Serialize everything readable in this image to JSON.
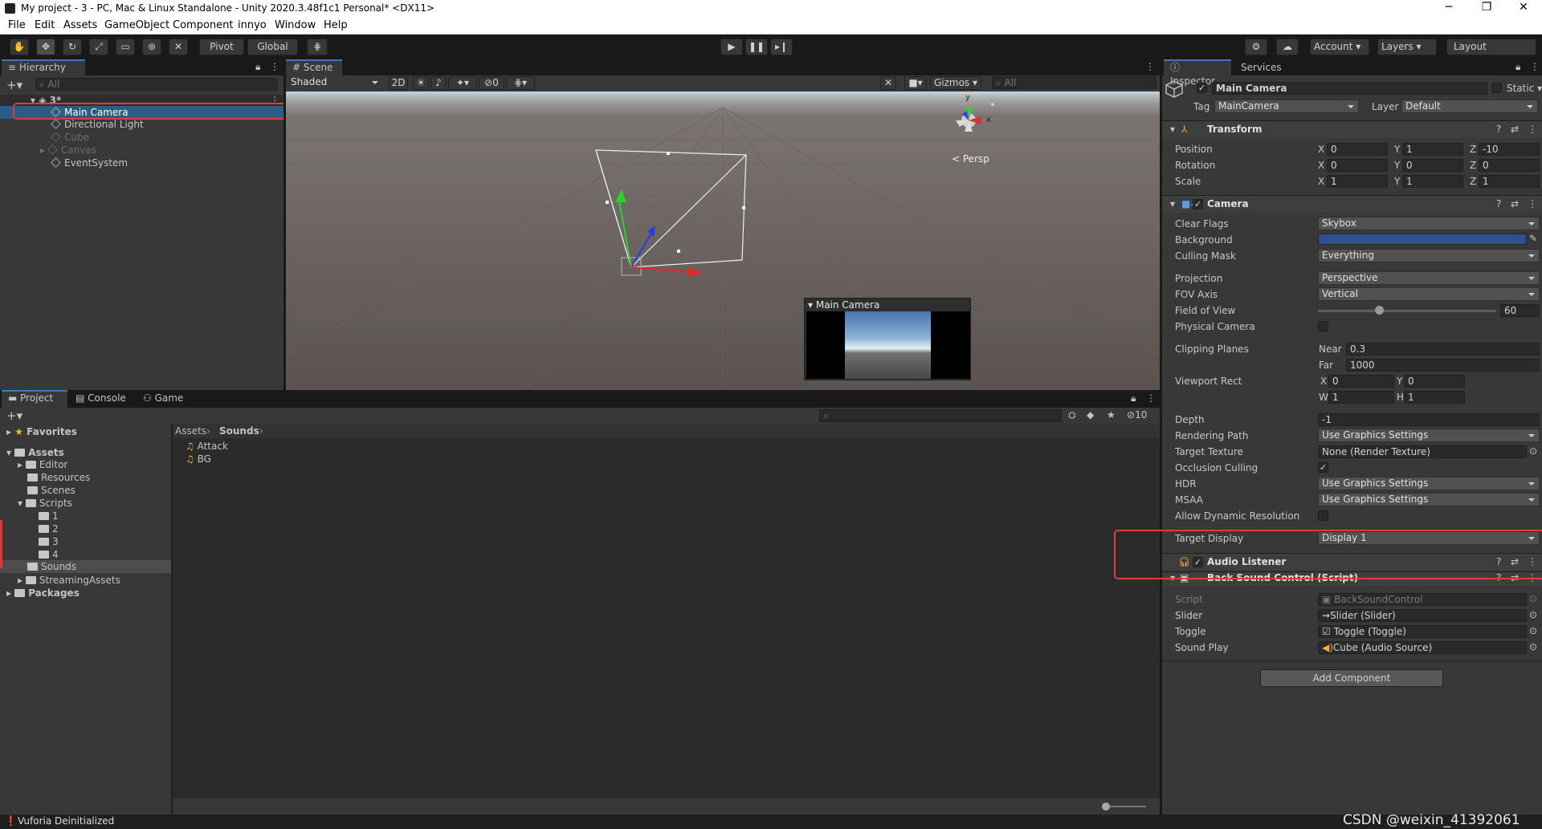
{
  "window": {
    "title": "My project - 3 - PC, Mac & Linux Standalone - Unity 2020.3.48f1c1 Personal* <DX11>",
    "min": "─",
    "max": "❐",
    "close": "✕"
  },
  "menu": [
    "File",
    "Edit",
    "Assets",
    "GameObject",
    "Component",
    "innyo",
    "Window",
    "Help"
  ],
  "toolbar": {
    "pivot": "Pivot",
    "global": "Global",
    "account": "Account",
    "layers": "Layers",
    "layout": "Layout"
  },
  "hierarchy": {
    "tab": "Hierarchy",
    "search_placeholder": "All",
    "scene": "3*",
    "items": [
      "Main Camera",
      "Directional Light",
      "Cube",
      "Canvas",
      "EventSystem"
    ]
  },
  "scene": {
    "tab": "Scene",
    "shading": "Shaded",
    "mode2d": "2D",
    "hidden_count": "0",
    "gizmos": "Gizmos",
    "search_placeholder": "All",
    "persp": "Persp",
    "axis_x": "x",
    "axis_y": "y",
    "preview_title": "Main Camera"
  },
  "project": {
    "tabs": [
      "Project",
      "Console",
      "Game"
    ],
    "favorites": "Favorites",
    "assets": "Assets",
    "tree": [
      "Editor",
      "Resources",
      "Scenes",
      "Scripts",
      "1",
      "2",
      "3",
      "4",
      "Sounds",
      "StreamingAssets"
    ],
    "packages": "Packages",
    "breadcrumb": [
      "Assets",
      "Sounds"
    ],
    "files": [
      "Attack",
      "BG"
    ],
    "hidden_count": "10"
  },
  "inspector": {
    "tabs": [
      "Inspector",
      "Services"
    ],
    "object_name": "Main Camera",
    "static": "Static",
    "tag_label": "Tag",
    "tag": "MainCamera",
    "layer_label": "Layer",
    "layer": "Default",
    "transform": {
      "title": "Transform",
      "rows": [
        {
          "label": "Position",
          "x": "0",
          "y": "1",
          "z": "-10"
        },
        {
          "label": "Rotation",
          "x": "0",
          "y": "0",
          "z": "0"
        },
        {
          "label": "Scale",
          "x": "1",
          "y": "1",
          "z": "1"
        }
      ]
    },
    "camera": {
      "title": "Camera",
      "clear_flags_label": "Clear Flags",
      "clear_flags": "Skybox",
      "background_label": "Background",
      "background_color": "#31508f",
      "culling_mask_label": "Culling Mask",
      "culling_mask": "Everything",
      "projection_label": "Projection",
      "projection": "Perspective",
      "fov_axis_label": "FOV Axis",
      "fov_axis": "Vertical",
      "fov_label": "Field of View",
      "fov": "60",
      "physical_label": "Physical Camera",
      "clipping_label": "Clipping Planes",
      "near_label": "Near",
      "near": "0.3",
      "far_label": "Far",
      "far": "1000",
      "viewport_label": "Viewport Rect",
      "vx": "0",
      "vy": "0",
      "vw": "1",
      "vh": "1",
      "depth_label": "Depth",
      "depth": "-1",
      "rendering_path_label": "Rendering Path",
      "rendering_path": "Use Graphics Settings",
      "target_texture_label": "Target Texture",
      "target_texture": "None (Render Texture)",
      "occlusion_label": "Occlusion Culling",
      "hdr_label": "HDR",
      "hdr": "Use Graphics Settings",
      "msaa_label": "MSAA",
      "msaa": "Use Graphics Settings",
      "dynres_label": "Allow Dynamic Resolution",
      "target_display_label": "Target Display",
      "target_display": "Display 1"
    },
    "audio_listener": {
      "title": "Audio Listener"
    },
    "script": {
      "title": "Back Sound Control (Script)",
      "script_label": "Script",
      "script": "BackSoundControl",
      "slider_label": "Slider",
      "slider": "Slider (Slider)",
      "toggle_label": "Toggle",
      "toggle": "Toggle (Toggle)",
      "sound_label": "Sound Play",
      "sound": "Cube (Audio Source)"
    },
    "add_component": "Add Component"
  },
  "status": {
    "text": "Vuforia Deinitialized",
    "watermark": "CSDN @weixin_41392061"
  }
}
